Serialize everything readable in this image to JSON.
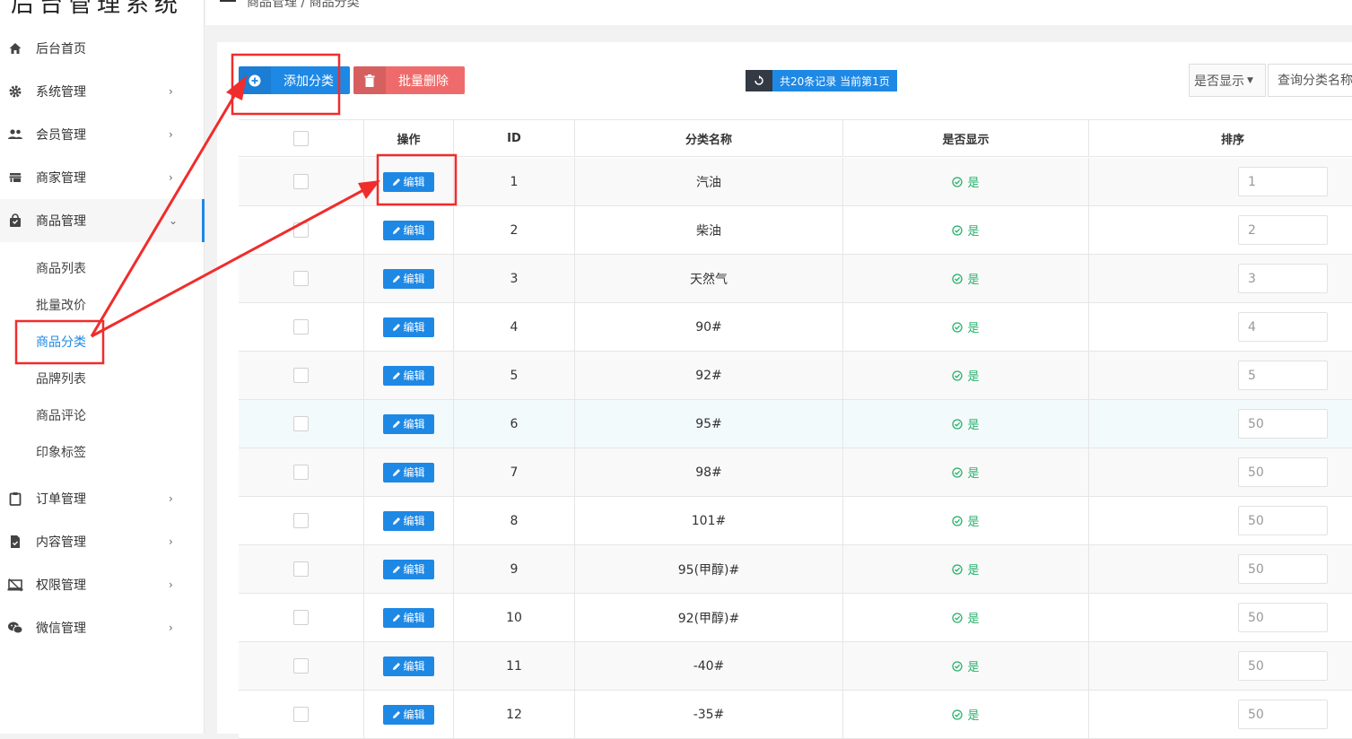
{
  "app": {
    "title": "后台管理系统"
  },
  "breadcrumb": {
    "text": "商品管理 / 商品分类"
  },
  "sidebar": {
    "items": [
      {
        "label": "后台首页"
      },
      {
        "label": "系统管理"
      },
      {
        "label": "会员管理"
      },
      {
        "label": "商家管理"
      },
      {
        "label": "商品管理"
      },
      {
        "label": "订单管理"
      },
      {
        "label": "内容管理"
      },
      {
        "label": "权限管理"
      },
      {
        "label": "微信管理"
      }
    ],
    "submenu": [
      {
        "label": "商品列表"
      },
      {
        "label": "批量改价"
      },
      {
        "label": "商品分类",
        "active": true
      },
      {
        "label": "品牌列表"
      },
      {
        "label": "商品评论"
      },
      {
        "label": "印象标签"
      }
    ]
  },
  "toolbar": {
    "add_label": "添加分类",
    "delete_label": "批量删除",
    "records_label": "共20条记录 当前第1页",
    "filter_select": "是否显示",
    "search_placeholder": "查询分类名称"
  },
  "table": {
    "headers": {
      "action": "操作",
      "id": "ID",
      "name": "分类名称",
      "show": "是否显示",
      "sort": "排序"
    },
    "edit_label": "编辑",
    "yes_label": "是",
    "rows": [
      {
        "id": "1",
        "name": "汽油",
        "sort": "1"
      },
      {
        "id": "2",
        "name": "柴油",
        "sort": "2"
      },
      {
        "id": "3",
        "name": "天然气",
        "sort": "3"
      },
      {
        "id": "4",
        "name": "90#",
        "sort": "4"
      },
      {
        "id": "5",
        "name": "92#",
        "sort": "5"
      },
      {
        "id": "6",
        "name": "95#",
        "sort": "50"
      },
      {
        "id": "7",
        "name": "98#",
        "sort": "50"
      },
      {
        "id": "8",
        "name": "101#",
        "sort": "50"
      },
      {
        "id": "9",
        "name": "95(甲醇)#",
        "sort": "50"
      },
      {
        "id": "10",
        "name": "92(甲醇)#",
        "sort": "50"
      },
      {
        "id": "11",
        "name": "-40#",
        "sort": "50"
      },
      {
        "id": "12",
        "name": "-35#",
        "sort": "50"
      }
    ]
  },
  "colors": {
    "primary": "#1e88e5",
    "danger": "#ef6b6b",
    "success": "#26b06b",
    "annotation": "#f02c2c"
  }
}
